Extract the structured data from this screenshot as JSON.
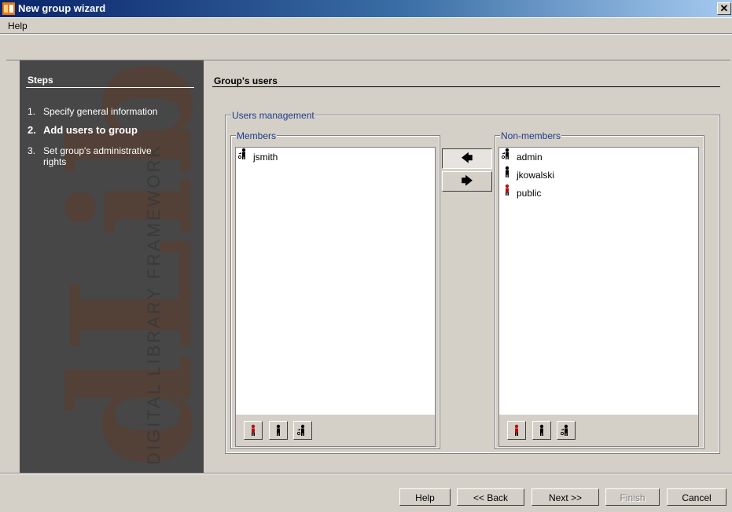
{
  "window": {
    "title": "New group wizard",
    "close_glyph": "✕",
    "app_icon": "wizard-app-icon"
  },
  "menu": {
    "help_label": "Help"
  },
  "steps": {
    "header": "Steps",
    "watermark_text": "dLibra",
    "vertical_text": "DIGITAL LIBRARY FRAMEWORK",
    "items": [
      {
        "num": "1.",
        "label": "Specify general information",
        "active": false
      },
      {
        "num": "2.",
        "label": "Add users to group",
        "active": true
      },
      {
        "num": "3.",
        "label": "Set group's administrative rights",
        "active": false
      }
    ]
  },
  "page": {
    "section_title": "Group's users",
    "users_management_legend": "Users management"
  },
  "members": {
    "legend": "Members",
    "items": [
      {
        "name": "jsmith",
        "icon": "admin-user-icon"
      }
    ]
  },
  "non_members": {
    "legend": "Non-members",
    "items": [
      {
        "name": "admin",
        "icon": "admin-user-icon"
      },
      {
        "name": "jkowalski",
        "icon": "user-icon"
      },
      {
        "name": "public",
        "icon": "public-user-icon"
      }
    ]
  },
  "transfer": {
    "add_glyph": "🡄",
    "remove_glyph": "🡆"
  },
  "footer": {
    "help": "Help",
    "back": "<< Back",
    "next": "Next >>",
    "finish": "Finish",
    "cancel": "Cancel"
  },
  "colors": {
    "title_bar": "#0a246a",
    "steps_panel_bg": "#474747",
    "legend_text": "#1f3b8a",
    "dialog_bg": "#d4d0c8"
  }
}
